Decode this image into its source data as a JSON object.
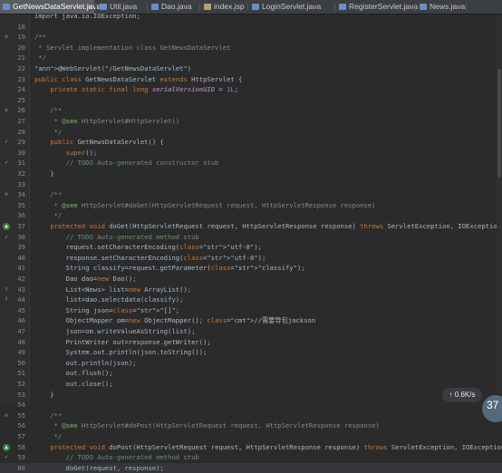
{
  "tabs": [
    {
      "label": "GetNewsDataServlet.java",
      "close": "×",
      "active": true,
      "type": "java"
    },
    {
      "label": "Util.java",
      "type": "java"
    },
    {
      "label": "Dao.java",
      "type": "java"
    },
    {
      "label": "index.jsp",
      "type": "jsp"
    },
    {
      "label": "LoginServlet.java",
      "type": "java"
    },
    {
      "label": "RegisterServlet.java",
      "type": "java"
    },
    {
      "label": "News.java",
      "type": "java"
    }
  ],
  "editor": {
    "lines": [
      {
        "n": "",
        "t": "import java.io.IOException;"
      },
      {
        "n": "18",
        "t": ""
      },
      {
        "n": "19",
        "t": "/**"
      },
      {
        "n": "20",
        "t": " * Servlet implementation class GetNewsDataServlet"
      },
      {
        "n": "21",
        "t": " */"
      },
      {
        "n": "22",
        "t": "@WebServlet(\"/GetNewsDataServlet\")"
      },
      {
        "n": "23",
        "t": "public class GetNewsDataServlet extends HttpServlet {"
      },
      {
        "n": "24",
        "t": "    private static final long serialVersionUID = 1L;"
      },
      {
        "n": "25",
        "t": ""
      },
      {
        "n": "26",
        "t": "    /**"
      },
      {
        "n": "27",
        "t": "     * @see HttpServlet#HttpServlet()"
      },
      {
        "n": "28",
        "t": "     */"
      },
      {
        "n": "29",
        "t": "    public GetNewsDataServlet() {"
      },
      {
        "n": "30",
        "t": "        super();"
      },
      {
        "n": "31",
        "t": "        // TODO Auto-generated constructor stub"
      },
      {
        "n": "32",
        "t": "    }"
      },
      {
        "n": "33",
        "t": ""
      },
      {
        "n": "34",
        "t": "    /**"
      },
      {
        "n": "35",
        "t": "     * @see HttpServlet#doGet(HttpServletRequest request, HttpServletResponse response)"
      },
      {
        "n": "36",
        "t": "     */"
      },
      {
        "n": "37",
        "t": "    protected void doGet(HttpServletRequest request, HttpServletResponse response) throws ServletException, IOException {"
      },
      {
        "n": "38",
        "t": "        // TODO Auto-generated method stub"
      },
      {
        "n": "39",
        "t": "        request.setCharacterEncoding(\"utf-8\");"
      },
      {
        "n": "40",
        "t": "        response.setCharacterEncoding(\"utf-8\");"
      },
      {
        "n": "41",
        "t": "        String classify=request.getParameter(\"classify\");"
      },
      {
        "n": "42",
        "t": "        Dao dao=new Dao();"
      },
      {
        "n": "43",
        "t": "        List<News> list=new ArrayList();"
      },
      {
        "n": "44",
        "t": "        list=dao.selectdata(classify);"
      },
      {
        "n": "45",
        "t": "        String json=\"[]\";"
      },
      {
        "n": "46",
        "t": "        ObjectMapper om=new ObjectMapper(); //需要导包jackson"
      },
      {
        "n": "47",
        "t": "        json=om.writeValueAsString(list);"
      },
      {
        "n": "48",
        "t": "        PrintWriter out=response.getWriter();"
      },
      {
        "n": "49",
        "t": "        System.out.println(json.toString());"
      },
      {
        "n": "50",
        "t": "        out.println(json);"
      },
      {
        "n": "51",
        "t": "        out.flush();"
      },
      {
        "n": "52",
        "t": "        out.close();"
      },
      {
        "n": "53",
        "t": "    }"
      },
      {
        "n": "54",
        "t": ""
      },
      {
        "n": "55",
        "t": "    /**"
      },
      {
        "n": "56",
        "t": "     * @see HttpServlet#doPost(HttpServletRequest request, HttpServletResponse response)"
      },
      {
        "n": "57",
        "t": "     */"
      },
      {
        "n": "58",
        "t": "    protected void doPost(HttpServletRequest request, HttpServletResponse response) throws ServletException, IOException {"
      },
      {
        "n": "59",
        "t": "        // TODO Auto-generated method stub"
      },
      {
        "n": "60",
        "t": "        doGet(request, response);"
      }
    ]
  },
  "overlay": {
    "speed": "0.6K/s",
    "circle_text": "37"
  }
}
